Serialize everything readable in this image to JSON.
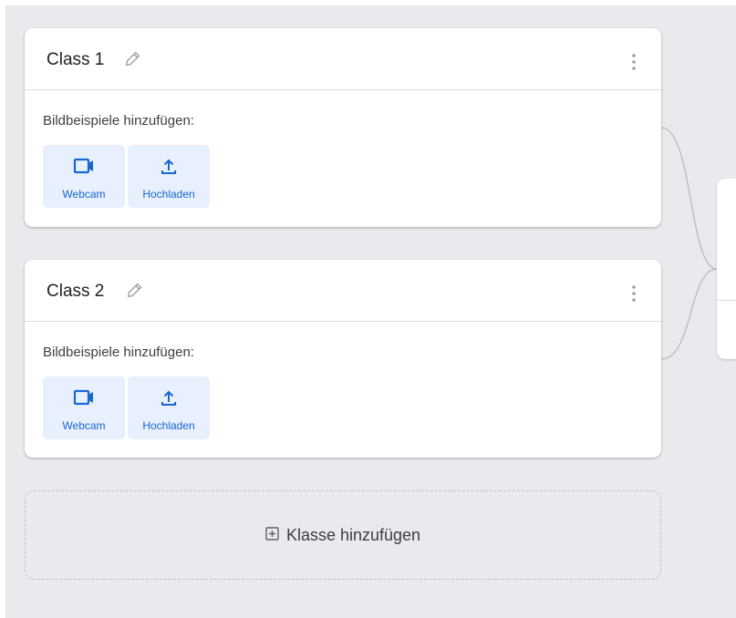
{
  "classes": [
    {
      "name": "Class 1",
      "add_samples_label": "Bildbeispiele hinzufügen:",
      "buttons": {
        "webcam": "Webcam",
        "upload": "Hochladen"
      }
    },
    {
      "name": "Class 2",
      "add_samples_label": "Bildbeispiele hinzufügen:",
      "buttons": {
        "webcam": "Webcam",
        "upload": "Hochladen"
      }
    }
  ],
  "add_class": {
    "label": "Klasse hinzufügen"
  },
  "icons": {
    "edit": "pencil-icon",
    "more": "more-vert-icon",
    "webcam": "videocam-icon",
    "upload": "upload-icon",
    "add": "add-box-icon"
  },
  "colors": {
    "background": "#e8eaed",
    "card": "#ffffff",
    "accent": "#1967d2",
    "button_bg": "#e8f0fe"
  }
}
